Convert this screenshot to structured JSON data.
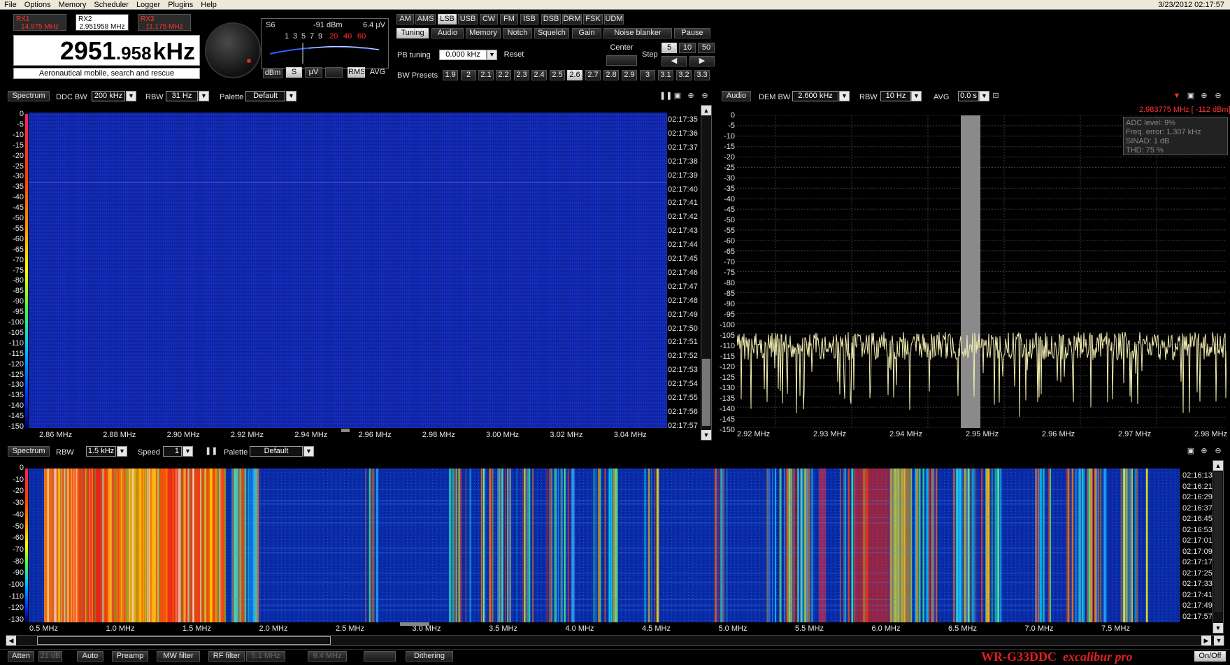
{
  "menu": [
    "File",
    "Options",
    "Memory",
    "Scheduler",
    "Logger",
    "Plugins",
    "Help"
  ],
  "datetime": "3/23/2012 02:17:57",
  "receivers": [
    {
      "name": "RX1",
      "freq": "14.975 MHz"
    },
    {
      "name": "RX2",
      "freq": "2.951958 MHz"
    },
    {
      "name": "RX3",
      "freq": "11.175 MHz"
    }
  ],
  "frequency": {
    "main": "2951",
    "decimals": ".958",
    "unit": "kHz"
  },
  "service": "Aeronautical mobile, search and rescue",
  "smeter": {
    "s": "S6",
    "dbm": "-91 dBm",
    "uv": "6.4 µV",
    "scale_black": [
      "1",
      "3",
      "5",
      "7",
      "9"
    ],
    "scale_red": [
      "20",
      "40",
      "60"
    ],
    "buttons": [
      "dBm",
      "S",
      "µV",
      "RMS",
      "AVG"
    ]
  },
  "modes": [
    "AM",
    "AMS",
    "LSB",
    "USB",
    "CW",
    "FM",
    "ISB",
    "DSB",
    "DRM",
    "FSK",
    "UDM"
  ],
  "active_mode": "LSB",
  "tabs": [
    "Tuning",
    "Audio",
    "Memory",
    "Notch",
    "Squelch",
    "Gain",
    "Noise blanker",
    "Pause"
  ],
  "pb_tuning": {
    "label": "PB tuning",
    "value": "0.000 kHz",
    "reset": "Reset"
  },
  "center_label": "Center",
  "step": {
    "label": "Step",
    "values": [
      "5",
      "10",
      "50"
    ]
  },
  "bw_presets": {
    "label": "BW Presets",
    "values": [
      "1.9",
      "2",
      "2.1",
      "2.2",
      "2.3",
      "2.4",
      "2.5",
      "2.6",
      "2.7",
      "2.8",
      "2.9",
      "3",
      "3.1",
      "3.2",
      "3.3"
    ],
    "active": "2.6"
  },
  "ddc_panel": {
    "spectrum": "Spectrum",
    "ddc_bw_label": "DDC BW",
    "ddc_bw": "200 kHz",
    "rbw_label": "RBW",
    "rbw": "31 Hz",
    "palette_label": "Palette",
    "palette": "Default",
    "db_ticks": [
      "0",
      "-5",
      "-10",
      "-15",
      "-20",
      "-25",
      "-30",
      "-35",
      "-40",
      "-45",
      "-50",
      "-55",
      "-60",
      "-65",
      "-70",
      "-75",
      "-80",
      "-85",
      "-90",
      "-95",
      "-100",
      "-105",
      "-110",
      "-115",
      "-120",
      "-125",
      "-130",
      "-135",
      "-140",
      "-145",
      "-150"
    ],
    "time_ticks": [
      "02:17:35",
      "02:17:36",
      "02:17:37",
      "02:17:38",
      "02:17:39",
      "02:17:40",
      "02:17:41",
      "02:17:42",
      "02:17:43",
      "02:17:44",
      "02:17:45",
      "02:17:46",
      "02:17:47",
      "02:17:48",
      "02:17:49",
      "02:17:50",
      "02:17:51",
      "02:17:52",
      "02:17:53",
      "02:17:54",
      "02:17:55",
      "02:17:56",
      "02:17:57"
    ],
    "freq_ticks": [
      "2.86 MHz",
      "2.88 MHz",
      "2.90 MHz",
      "2.92 MHz",
      "2.94 MHz",
      "2.96 MHz",
      "2.98 MHz",
      "3.00 MHz",
      "3.02 MHz",
      "3.04 MHz"
    ]
  },
  "audio_panel": {
    "audio": "Audio",
    "dem_bw_label": "DEM BW",
    "dem_bw": "2.600 kHz",
    "rbw_label": "RBW",
    "rbw": "10 Hz",
    "avg_label": "AVG",
    "avg": "0.0 s",
    "cursor": "2.983775 MHz [ -112 dBm]",
    "stats": [
      "ADC level: 9%",
      "Freq. error: 1.307 kHz",
      "SINAD: 1 dB",
      "THD: 75 %"
    ],
    "db_ticks": [
      "0",
      "-5",
      "-10",
      "-15",
      "-20",
      "-25",
      "-30",
      "-35",
      "-40",
      "-45",
      "-50",
      "-55",
      "-60",
      "-65",
      "-70",
      "-75",
      "-80",
      "-85",
      "-90",
      "-95",
      "-100",
      "-105",
      "-110",
      "-115",
      "-120",
      "-125",
      "-130",
      "-135",
      "-140",
      "-145",
      "-150"
    ],
    "freq_ticks": [
      "2.92 MHz",
      "2.93 MHz",
      "2.94 MHz",
      "2.95 MHz",
      "2.96 MHz",
      "2.97 MHz",
      "2.98 MHz"
    ]
  },
  "wide_panel": {
    "spectrum": "Spectrum",
    "rbw_label": "RBW",
    "rbw": "1.5 kHz",
    "speed_label": "Speed",
    "speed": "1",
    "palette_label": "Palette",
    "palette": "Default",
    "db_ticks": [
      "0",
      "-10",
      "-20",
      "-30",
      "-40",
      "-50",
      "-60",
      "-70",
      "-80",
      "-90",
      "-100",
      "-110",
      "-120",
      "-130"
    ],
    "time_ticks": [
      "02:16:13",
      "02:16:21",
      "02:16:29",
      "02:16:37",
      "02:16:45",
      "02:16:53",
      "02:17:01",
      "02:17:09",
      "02:17:17",
      "02:17:25",
      "02:17:33",
      "02:17:41",
      "02:17:49",
      "02:17:57"
    ],
    "freq_ticks": [
      "0.5 MHz",
      "1.0 MHz",
      "1.5 MHz",
      "2.0 MHz",
      "2.5 MHz",
      "3.0 MHz",
      "3.5 MHz",
      "4.0 MHz",
      "4.5 MHz",
      "5.0 MHz",
      "5.5 MHz",
      "6.0 MHz",
      "6.5 MHz",
      "7.0 MHz",
      "7.5 MHz"
    ]
  },
  "bottom": {
    "atten": "Atten",
    "atten_val": "21 dB",
    "auto": "Auto",
    "preamp": "Preamp",
    "mw": "MW filter",
    "rf": "RF filter",
    "rf_low": "5.1 MHz",
    "rf_high": "9.4 MHz",
    "dithering": "Dithering",
    "onoff": "On/Off"
  },
  "brand": {
    "model": "WR-G33DDC",
    "edition": "excalibur pro"
  }
}
